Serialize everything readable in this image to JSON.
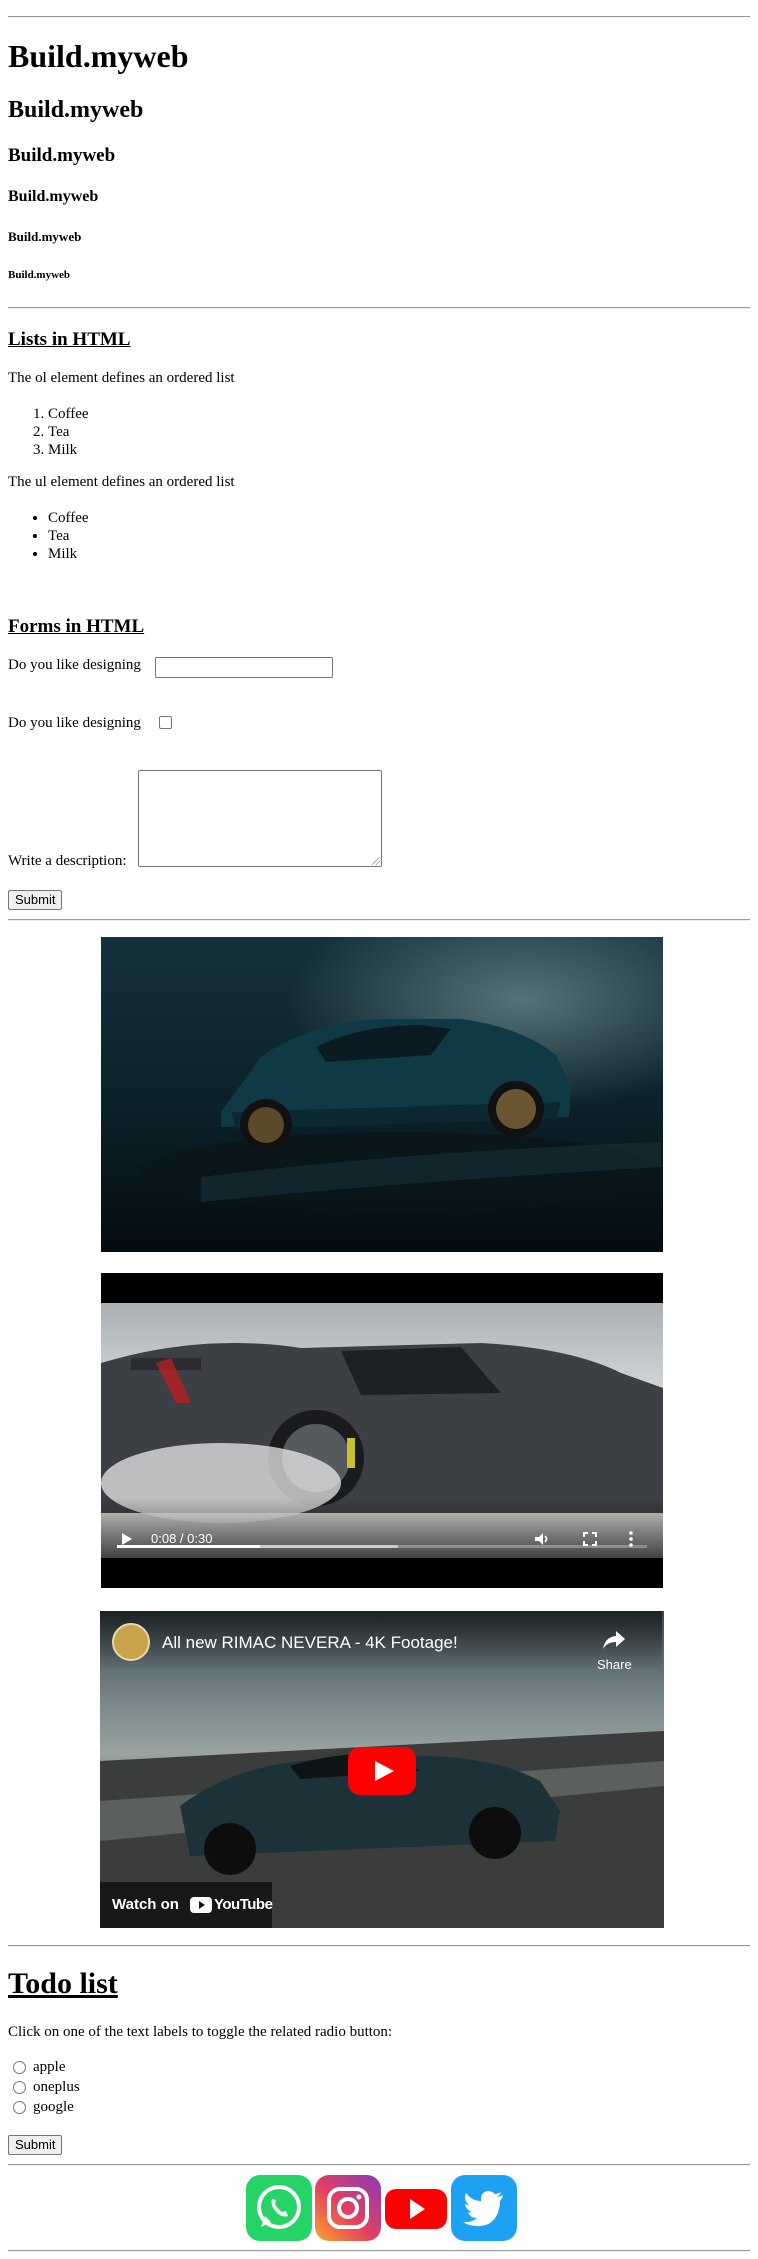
{
  "headings": {
    "h1": "Build.myweb",
    "h2": "Build.myweb",
    "h3": "Build.myweb",
    "h4": "Build.myweb",
    "h5": "Build.myweb",
    "h6": "Build.myweb"
  },
  "lists_section": {
    "title": "Lists in HTML",
    "ol_intro": "The ol element defines an ordered list",
    "ol_items": [
      "Coffee",
      "Tea",
      "Milk"
    ],
    "ul_intro": "The ul element defines an ordered list",
    "ul_items": [
      "Coffee",
      "Tea",
      "Milk"
    ]
  },
  "forms_section": {
    "title": "Forms in HTML",
    "text_label": "Do you like designing",
    "text_value": "",
    "checkbox_label": "Do you like designing",
    "textarea_label": "Write a description:",
    "submit_label": "Submit"
  },
  "video_player": {
    "time_display": "0:08 / 0:30",
    "played_fraction": 0.27,
    "buffered_fraction": 0.53
  },
  "youtube_embed": {
    "title": "All new RIMAC NEVERA - 4K Footage!",
    "share_label": "Share",
    "watch_on_label": "Watch on",
    "youtube_wordmark": "YouTube"
  },
  "todo_section": {
    "title": "Todo list",
    "instructions": "Click on one of the text labels to toggle the related radio button:",
    "options": [
      "apple",
      "oneplus",
      "google"
    ],
    "submit_label": "Submit"
  },
  "social_icons": [
    {
      "name": "whatsapp-icon",
      "color": "#25D366"
    },
    {
      "name": "instagram-icon",
      "color": "#C13584"
    },
    {
      "name": "youtube-icon",
      "color": "#FF0000"
    },
    {
      "name": "twitter-icon",
      "color": "#1DA1F2"
    }
  ]
}
